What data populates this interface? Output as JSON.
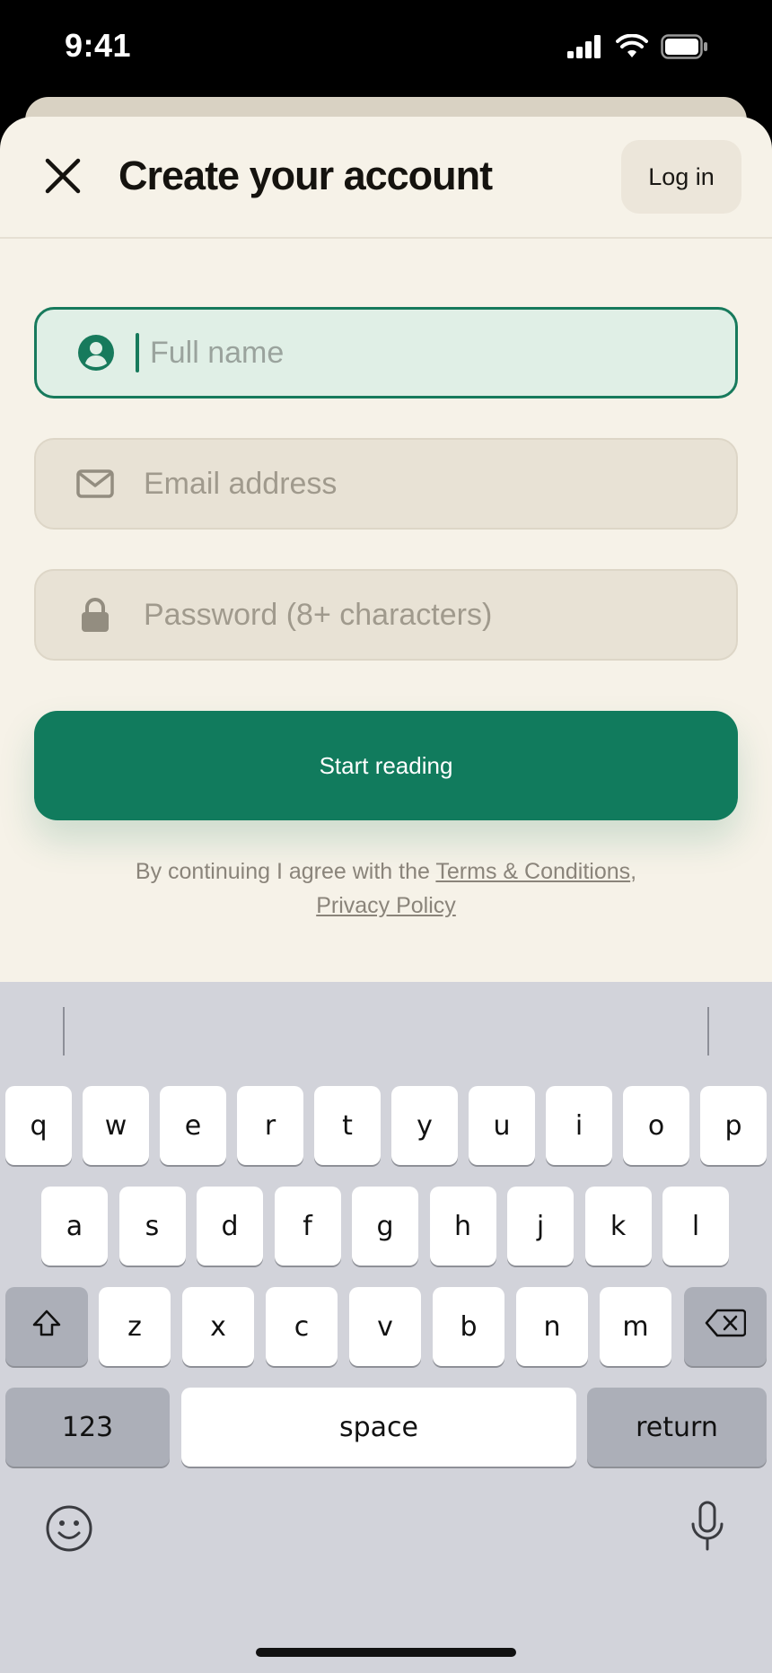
{
  "status_bar": {
    "time": "9:41"
  },
  "header": {
    "title": "Create your account",
    "login_label": "Log in"
  },
  "form": {
    "full_name": {
      "placeholder": "Full name",
      "value": ""
    },
    "email": {
      "placeholder": "Email address",
      "value": ""
    },
    "password": {
      "placeholder": "Password (8+ characters)",
      "value": ""
    },
    "submit_label": "Start reading"
  },
  "legal": {
    "prefix": "By continuing I agree with the",
    "terms": "Terms & Conditions",
    "separator": ",",
    "privacy": "Privacy Policy"
  },
  "keyboard": {
    "row1": [
      "q",
      "w",
      "e",
      "r",
      "t",
      "y",
      "u",
      "i",
      "o",
      "p"
    ],
    "row2": [
      "a",
      "s",
      "d",
      "f",
      "g",
      "h",
      "j",
      "k",
      "l"
    ],
    "row3": [
      "z",
      "x",
      "c",
      "v",
      "b",
      "n",
      "m"
    ],
    "numbers_label": "123",
    "space_label": "space",
    "return_label": "return"
  },
  "colors": {
    "accent": "#117b5d",
    "sheet": "#f6f2e8",
    "field": "#e8e2d5",
    "keyboard": "#d2d3da"
  }
}
